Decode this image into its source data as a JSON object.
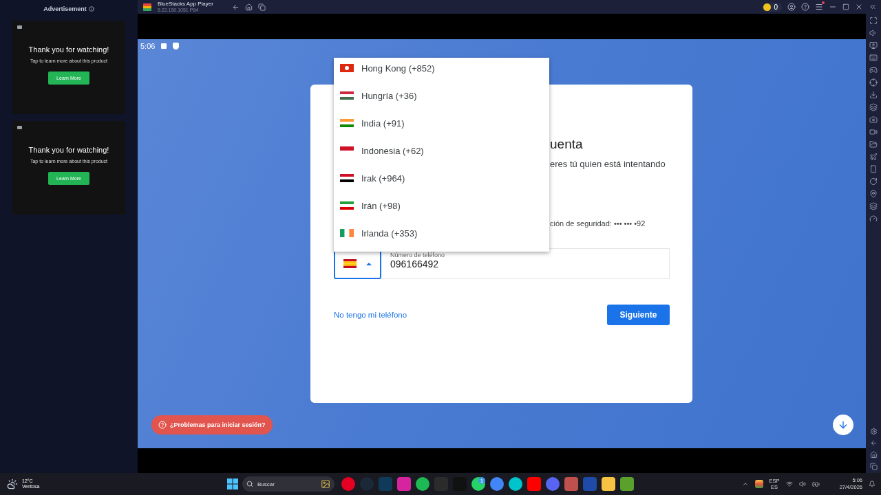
{
  "ads": {
    "header": "Advertisement",
    "cards": [
      {
        "title": "Thank you for watching!",
        "text": "Tap to learn more about this product",
        "button": "Learn More"
      },
      {
        "title": "Thank you for watching!",
        "text": "Tap to learn more about this product",
        "button": "Learn More"
      }
    ]
  },
  "titlebar": {
    "app_name": "BlueStacks App Player",
    "version": "5.22.150.1051 P64",
    "coins": "0",
    "menu_notification": true
  },
  "phone": {
    "status_time": "5:06",
    "card": {
      "title": "uenta",
      "text": "eres tú quien está intentando",
      "hint": "ción de seguridad: ••• ••• •92",
      "country": {
        "kind": "es",
        "expanded": true
      },
      "phone_label": "Número de teléfono",
      "phone_value": "096166492",
      "link": "No tengo mi teléfono",
      "button": "Siguiente"
    },
    "dropdown": [
      {
        "label": "Hong Kong (+852)",
        "kind": "hk"
      },
      {
        "label": "Hungría (+36)",
        "kind": "hu"
      },
      {
        "label": "India (+91)",
        "kind": "in"
      },
      {
        "label": "Indonesia (+62)",
        "kind": "id"
      },
      {
        "label": "Irak (+964)",
        "kind": "iq"
      },
      {
        "label": "Irán (+98)",
        "kind": "ir"
      },
      {
        "label": "Irlanda (+353)",
        "kind": "ie"
      }
    ],
    "help_button": "¿Problemas para iniciar sesión?"
  },
  "taskbar": {
    "temperature": "12°C",
    "weather": "Ventosa",
    "search_placeholder": "Buscar",
    "message_badge": "1",
    "language": "ESP",
    "region": "ES",
    "time": "5:06",
    "date": "27/4/2026"
  }
}
